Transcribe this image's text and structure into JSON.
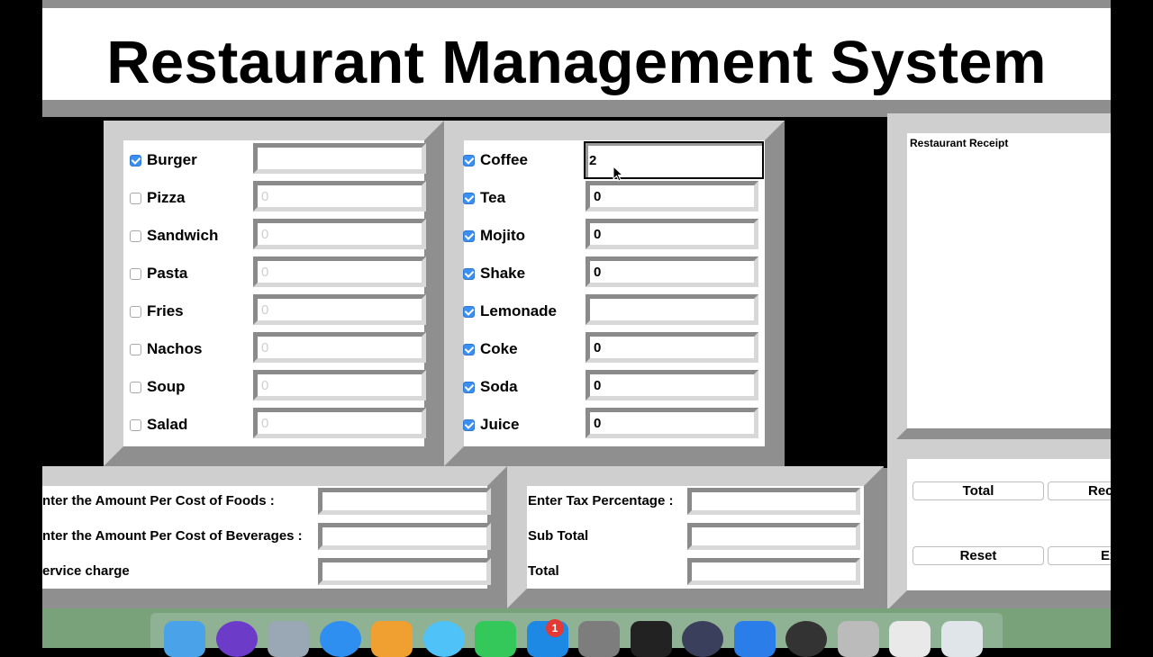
{
  "app": {
    "title": "Restaurant Management System"
  },
  "foods": [
    {
      "label": "Burger",
      "checked": true,
      "value": ""
    },
    {
      "label": "Pizza",
      "checked": false,
      "value": "0"
    },
    {
      "label": "Sandwich",
      "checked": false,
      "value": "0"
    },
    {
      "label": "Pasta",
      "checked": false,
      "value": "0"
    },
    {
      "label": "Fries",
      "checked": false,
      "value": "0"
    },
    {
      "label": "Nachos",
      "checked": false,
      "value": "0"
    },
    {
      "label": "Soup",
      "checked": false,
      "value": "0"
    },
    {
      "label": "Salad",
      "checked": false,
      "value": "0"
    }
  ],
  "drinks": [
    {
      "label": "Coffee",
      "checked": true,
      "value": "2"
    },
    {
      "label": "Tea",
      "checked": true,
      "value": "0"
    },
    {
      "label": "Mojito",
      "checked": true,
      "value": "0"
    },
    {
      "label": "Shake",
      "checked": true,
      "value": "0"
    },
    {
      "label": "Lemonade",
      "checked": true,
      "value": ""
    },
    {
      "label": "Coke",
      "checked": true,
      "value": "0"
    },
    {
      "label": "Soda",
      "checked": true,
      "value": "0"
    },
    {
      "label": "Juice",
      "checked": true,
      "value": "0"
    }
  ],
  "receipt": {
    "title": "Restaurant Receipt"
  },
  "costs": {
    "food_label": "nter the Amount Per Cost of Foods :",
    "beverage_label": "nter the Amount Per Cost of Beverages :",
    "service_label": "ervice charge",
    "tax_label": "Enter Tax Percentage :",
    "subtotal_label": "Sub Total",
    "total_label": "Total"
  },
  "buttons": {
    "total": "Total",
    "receipt": "Rec",
    "reset": "Reset",
    "exit": "Ex"
  },
  "dock": {
    "badge_count": "1",
    "icons": [
      "finder-icon",
      "siri-icon",
      "launchpad-icon",
      "safari-icon",
      "photos-icon",
      "messages-icon",
      "facetime-icon",
      "app-store-icon",
      "system-preferences-icon",
      "terminal-icon",
      "eclipse-icon",
      "keynote-icon",
      "quicktime-icon",
      "script-editor-icon",
      "preview-icon",
      "trash-icon"
    ]
  },
  "colors": {
    "checkbox_accent": "#3b8ff0",
    "panel_gray": "#8e8e8e"
  }
}
